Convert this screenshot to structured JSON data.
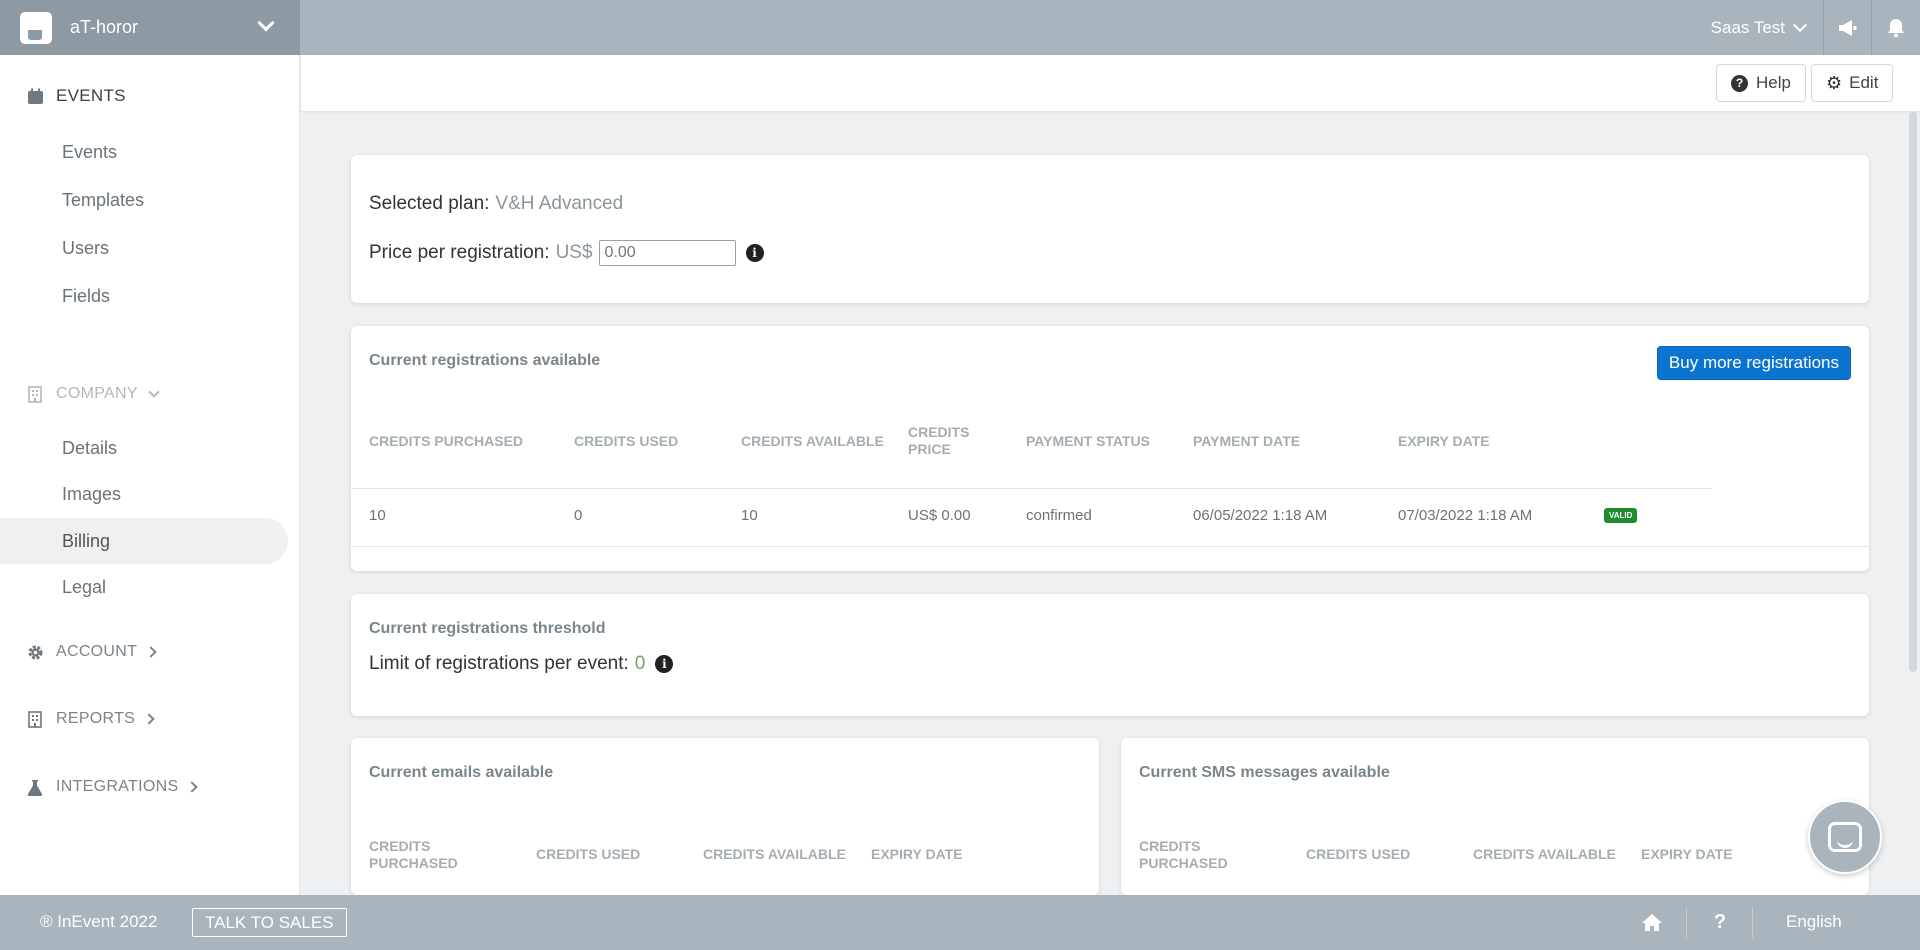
{
  "app": {
    "org_name": "aT-horor",
    "user_name": "Saas Test"
  },
  "header_buttons": {
    "help": "Help",
    "edit": "Edit"
  },
  "sidebar": {
    "events_heading": "EVENTS",
    "events_items": [
      "Events",
      "Templates",
      "Users",
      "Fields"
    ],
    "company_heading": "COMPANY",
    "company_items": [
      "Details",
      "Images",
      "Billing",
      "Legal"
    ],
    "active_item": "Billing",
    "account_heading": "ACCOUNT",
    "reports_heading": "REPORTS",
    "integrations_heading": "INTEGRATIONS"
  },
  "plan": {
    "selected_label": "Selected plan:",
    "selected_value": "V&H Advanced",
    "price_label": "Price per registration:",
    "currency": "US$",
    "price_placeholder": "0.00",
    "info_glyph": "i"
  },
  "registrations": {
    "title": "Current registrations available",
    "buy_button": "Buy more registrations",
    "columns": [
      "CREDITS PURCHASED",
      "CREDITS USED",
      "CREDITS AVAILABLE",
      "CREDITS PRICE",
      "PAYMENT STATUS",
      "PAYMENT DATE",
      "EXPIRY DATE"
    ],
    "rows": [
      {
        "purchased": "10",
        "used": "0",
        "available": "10",
        "price": "US$ 0.00",
        "status": "confirmed",
        "payment_date": "06/05/2022 1:18 AM",
        "expiry_date": "07/03/2022 1:18 AM",
        "badge": "VALID"
      }
    ]
  },
  "threshold": {
    "title": "Current registrations threshold",
    "limit_label": "Limit of registrations per event:",
    "limit_value": "0"
  },
  "emails": {
    "title": "Current emails available",
    "columns": [
      "CREDITS PURCHASED",
      "CREDITS USED",
      "CREDITS AVAILABLE",
      "EXPIRY DATE"
    ]
  },
  "sms": {
    "title": "Current SMS messages available",
    "columns": [
      "CREDITS PURCHASED",
      "CREDITS USED",
      "CREDITS AVAILABLE",
      "EXPIRY DATE"
    ]
  },
  "footer": {
    "copyright": "® InEvent 2022",
    "talk_to_sales": "TALK TO SALES",
    "language": "English"
  },
  "colors": {
    "primary_button": "#0b74d1",
    "valid_badge": "#1f8c2e",
    "topbar": "#a9b4bc",
    "accent_value": "#7aa05a"
  },
  "icons": [
    "logo-icon",
    "chevron-down-icon",
    "megaphone-icon",
    "bell-icon",
    "calendar-icon",
    "building-icon",
    "gear-icon",
    "flask-icon",
    "question-circle-icon",
    "info-icon",
    "home-icon",
    "question-icon",
    "chat-icon"
  ]
}
